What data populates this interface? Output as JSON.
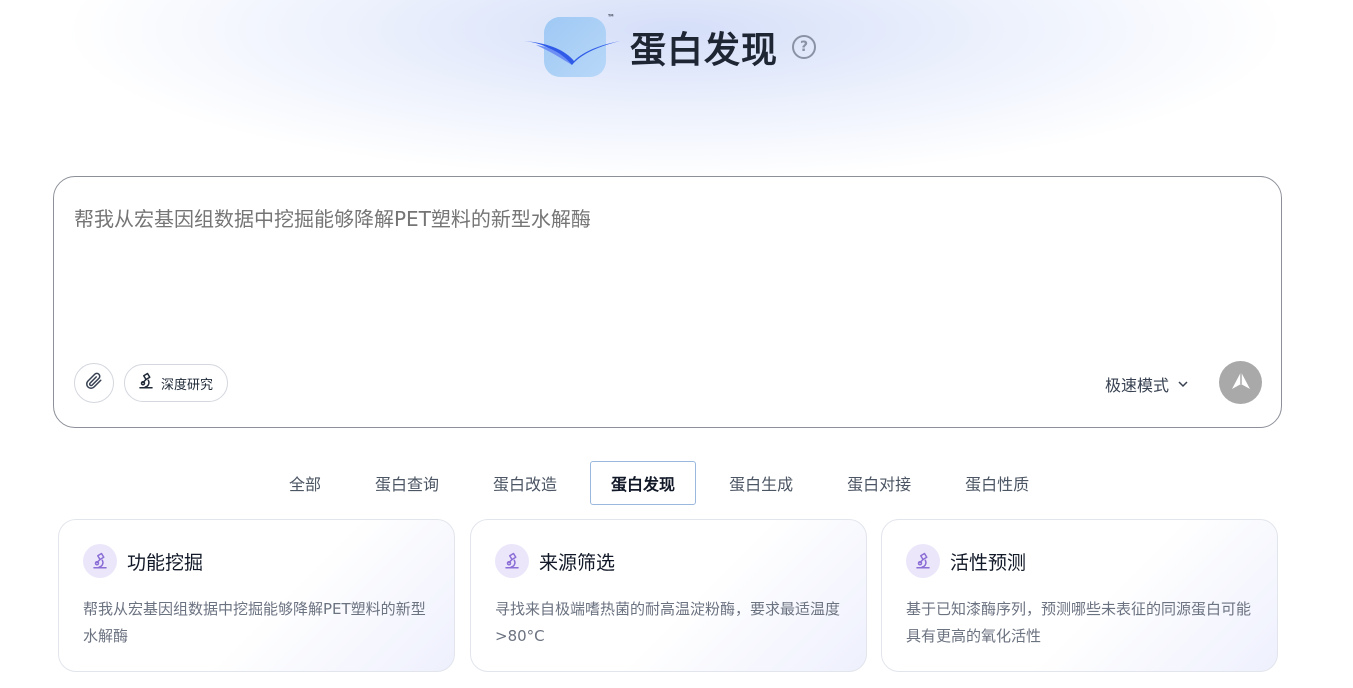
{
  "header": {
    "title": "蛋白发现",
    "logo_mark": "™",
    "help_symbol": "?"
  },
  "input": {
    "placeholder": "帮我从宏基因组数据中挖掘能够降解PET塑料的新型水解酶",
    "deep_research_label": "深度研究",
    "mode_label": "极速模式"
  },
  "tabs": [
    {
      "label": "全部"
    },
    {
      "label": "蛋白查询"
    },
    {
      "label": "蛋白改造"
    },
    {
      "label": "蛋白发现",
      "active": true
    },
    {
      "label": "蛋白生成"
    },
    {
      "label": "蛋白对接"
    },
    {
      "label": "蛋白性质"
    }
  ],
  "cards": [
    {
      "title": "功能挖掘",
      "description": "帮我从宏基因组数据中挖掘能够降解PET塑料的新型水解酶"
    },
    {
      "title": "来源筛选",
      "description": "寻找来自极端嗜热菌的耐高温淀粉酶，要求最适温度>80°C"
    },
    {
      "title": "活性预测",
      "description": "基于已知漆酶序列，预测哪些未表征的同源蛋白可能具有更高的氧化活性"
    }
  ],
  "colors": {
    "accent": "#2f5be8",
    "placeholder": "#97a6bd",
    "send_button": "#a9a9a9",
    "card_icon_bg": "#ebe6fa",
    "active_tab_border": "#9ab8de"
  },
  "icons": {
    "logo": "bird-logo-icon",
    "help": "question-circle-icon",
    "attach": "paperclip-icon",
    "deep_research": "microscope-icon",
    "mode_dropdown": "chevron-down-icon",
    "send": "send-arrow-icon",
    "card": "microscope-icon"
  }
}
